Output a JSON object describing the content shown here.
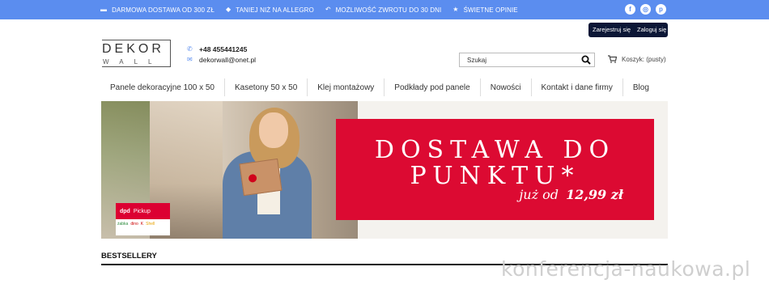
{
  "topbar": {
    "perks": [
      {
        "icon": "truck-icon",
        "glyph": "▬",
        "label": "DARMOWA DOSTAWA OD 300 ZŁ"
      },
      {
        "icon": "tag-icon",
        "glyph": "◆",
        "label": "TANIEJ NIŻ NA ALLEGRO"
      },
      {
        "icon": "return-icon",
        "glyph": "↶",
        "label": "MOŻLIWOŚĆ ZWROTU DO 30 DNI"
      },
      {
        "icon": "star-icon",
        "glyph": "★",
        "label": "ŚWIETNE OPINIE"
      }
    ],
    "social": [
      {
        "icon": "facebook-icon",
        "glyph": "f"
      },
      {
        "icon": "instagram-icon",
        "glyph": "◎"
      },
      {
        "icon": "pinterest-icon",
        "glyph": "p"
      }
    ]
  },
  "header": {
    "logo_top": "DEKOR",
    "logo_bottom": "WALL",
    "phone": "+48 455441245",
    "email": "dekorwall@onet.pl",
    "register_label": "Zarejestruj się",
    "login_label": "Zaloguj się",
    "search_placeholder": "Szukaj",
    "cart_label": "Koszyk: (pusty)"
  },
  "nav": {
    "items": [
      "Panele dekoracyjne 100 x 50",
      "Kasetony 50 x 50",
      "Klej montażowy",
      "Podkłady pod panele",
      "Nowości",
      "Kontakt i dane firmy",
      "Blog"
    ]
  },
  "hero": {
    "line1": "DOSTAWA DO",
    "line2": "PUNKTU*",
    "line3_prefix": "już od",
    "line3_price": "12,99 zł",
    "pickup_brand": "dpd",
    "pickup_label": "Pickup",
    "pickup_partners": [
      "żabka",
      "dino",
      "K",
      "Shell"
    ]
  },
  "section": {
    "bestsellers_title": "BESTSELLERY"
  },
  "watermark": "konferencja-naukowa.pl",
  "colors": {
    "topbar": "#5b8def",
    "auth_button": "#0c1736",
    "hero_red": "#dc0a32"
  }
}
